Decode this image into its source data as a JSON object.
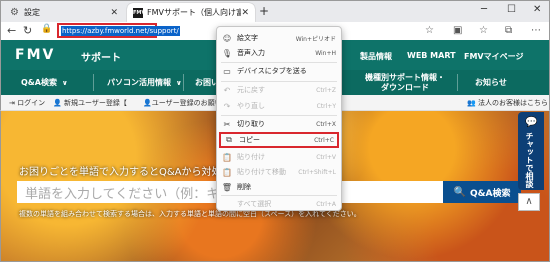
{
  "browser": {
    "tabs": [
      {
        "title": "設定",
        "icon": "gear-icon"
      },
      {
        "title": "FMVサポート（個人向け富士通パ",
        "icon": "fmv-favicon"
      }
    ],
    "new_tab": "+",
    "url": "https://azby.fmworld.net/support/"
  },
  "site": {
    "logo": "FMV",
    "section": "サポート",
    "header_links": [
      "製品情報",
      "WEB MART",
      "FMVマイページ"
    ],
    "nav": [
      {
        "label": "Q&A検索"
      },
      {
        "label": "パソコン活用情報"
      },
      {
        "label": "お困い"
      },
      {
        "line1": "機種別サポート情報・",
        "line2": "ダウンロード"
      },
      {
        "label": "お知らせ"
      }
    ],
    "login": {
      "login": "ログイン",
      "register": "新規ユーザー登録",
      "user_reg": "ユーザー登録のお願い",
      "corporate": "法人のお客様はこちら"
    },
    "hero": {
      "prompt": "お困りごとを単語で入力するとQ&Aから対処方法を",
      "search_placeholder": "単語を入力してください（例：キー",
      "search_button": "Q&A検索",
      "hint": "複数の単語を組み合わせて検索する場合は、入力する単語と単語の間に空白（スペース）を入れてください。"
    },
    "chat_label": "チャットで相談"
  },
  "context_menu": {
    "items": [
      {
        "label": "絵文字",
        "shortcut": "Win+ピリオド",
        "icon": "emoji-icon",
        "disabled": false
      },
      {
        "label": "音声入力",
        "shortcut": "Win+H",
        "icon": "microphone-icon",
        "disabled": false
      },
      {
        "label": "デバイスにタブを送る",
        "shortcut": "",
        "icon": "device-icon",
        "disabled": false
      },
      {
        "label": "元に戻す",
        "shortcut": "Ctrl+Z",
        "icon": "undo-icon",
        "disabled": true
      },
      {
        "label": "やり直し",
        "shortcut": "Ctrl+Y",
        "icon": "redo-icon",
        "disabled": true
      },
      {
        "label": "切り取り",
        "shortcut": "Ctrl+X",
        "icon": "cut-icon",
        "disabled": false
      },
      {
        "label": "コピー",
        "shortcut": "Ctrl+C",
        "icon": "copy-icon",
        "disabled": false
      },
      {
        "label": "貼り付け",
        "shortcut": "Ctrl+V",
        "icon": "paste-icon",
        "disabled": true
      },
      {
        "label": "貼り付けて移動",
        "shortcut": "Ctrl+Shift+L",
        "icon": "paste-go-icon",
        "disabled": true
      },
      {
        "label": "削除",
        "shortcut": "",
        "icon": "delete-icon",
        "disabled": false
      },
      {
        "label": "すべて選択",
        "shortcut": "Ctrl+A",
        "icon": "",
        "disabled": true
      }
    ]
  },
  "colors": {
    "header_bg": "#0e7369",
    "nav_bg": "#0c6a60",
    "highlight": "#d9272e",
    "search_button": "#0a4f8f",
    "chat_bg": "#0d3f76"
  }
}
